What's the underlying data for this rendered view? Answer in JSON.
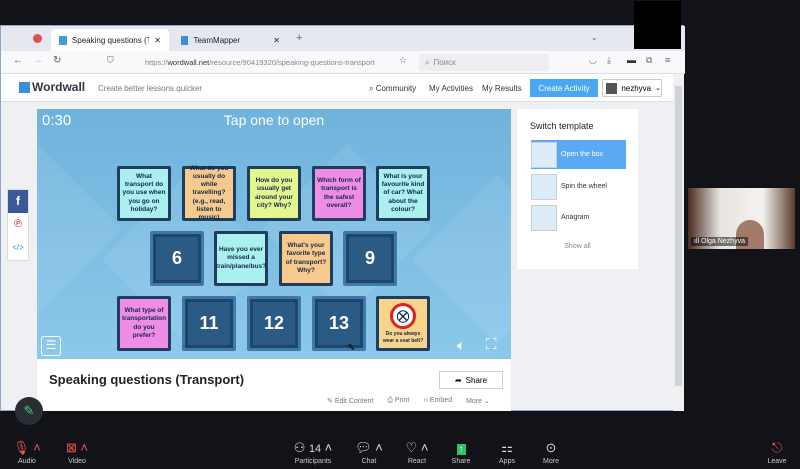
{
  "browser": {
    "tabs": [
      {
        "label": "Speaking questions (Transport"
      },
      {
        "label": "TeamMapper"
      }
    ],
    "url_prefix": "https://",
    "url_domain": "wordwall.net",
    "url_path": "/resource/90419320/speaking-questions-transport",
    "search_placeholder": "Поиск"
  },
  "wordwall": {
    "logo": "Wordwall",
    "tagline": "Create better lessons quicker",
    "nav": [
      "Community",
      "My Activities",
      "My Results"
    ],
    "create": "Create Activity",
    "user": "nezhyva"
  },
  "game": {
    "timer": "0:30",
    "instruction": "Tap one to open",
    "cards": [
      {
        "text": "What transport do you use when you go on holiday?",
        "color": "#a9f0ee"
      },
      {
        "text": "What do you usually do while travelling? (e.g., read, listen to music)",
        "color": "#f8c98c"
      },
      {
        "text": "How do you usually get around your city? Why?",
        "color": "#e3f78e"
      },
      {
        "text": "Which form of transport is the safest overall?",
        "color": "#ef8de6"
      },
      {
        "text": "What is your favourite kind of car? What about the colour?",
        "color": "#a9f0ee"
      },
      {
        "text": "6",
        "num": true
      },
      {
        "text": "Have you ever missed a train/plane/bus?",
        "color": "#a9f0ee"
      },
      {
        "text": "What's your favorite type of transport? Why?",
        "color": "#f8c98c"
      },
      {
        "text": "9",
        "num": true
      },
      {
        "text": "What type of transportation do you prefer?",
        "color": "#ef8de6"
      },
      {
        "text": "11",
        "num": true
      },
      {
        "text": "12",
        "num": true
      },
      {
        "text": "13",
        "num": true
      },
      {
        "text": "Do you always wear a seat belt?",
        "color": "#f8d48c",
        "image": "seatbelt-icon"
      }
    ]
  },
  "activity": {
    "title": "Speaking questions (Transport)",
    "share": "Share",
    "actions": [
      "Edit Content",
      "Print",
      "Embed",
      "More"
    ]
  },
  "sidebar": {
    "title": "Switch template",
    "templates": [
      "Open the box",
      "Spin the wheel",
      "Anagram"
    ],
    "show_all": "Show all"
  },
  "video": {
    "name": "Olga Nezhyva"
  },
  "zoom": {
    "audio": "Audio",
    "video": "Video",
    "participants": "Participants",
    "participant_count": "14",
    "chat": "Chat",
    "react": "React",
    "share": "Share",
    "apps": "Apps",
    "more": "More",
    "leave": "Leave"
  }
}
